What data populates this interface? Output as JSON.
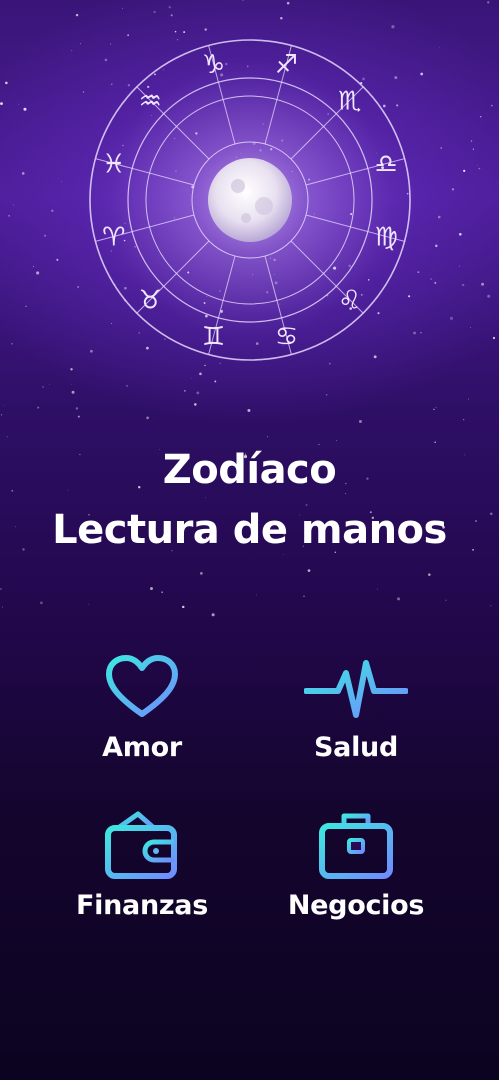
{
  "headline": {
    "line1": "Zodíaco",
    "line2": "Lectura de manos"
  },
  "features": [
    {
      "label": "Amor",
      "icon": "heart-icon"
    },
    {
      "label": "Salud",
      "icon": "heartbeat-icon"
    },
    {
      "label": "Finanzas",
      "icon": "wallet-icon"
    },
    {
      "label": "Negocios",
      "icon": "briefcase-icon"
    }
  ],
  "zodiac_signs": [
    "♑",
    "♐",
    "♏",
    "♎",
    "♍",
    "♌",
    "♋",
    "♊",
    "♉",
    "♈",
    "♓",
    "♒"
  ],
  "colors": {
    "icon_gradient_start": "#3ee7e0",
    "icon_gradient_end": "#6f8cff",
    "wheel_stroke": "#e6d7ff"
  }
}
